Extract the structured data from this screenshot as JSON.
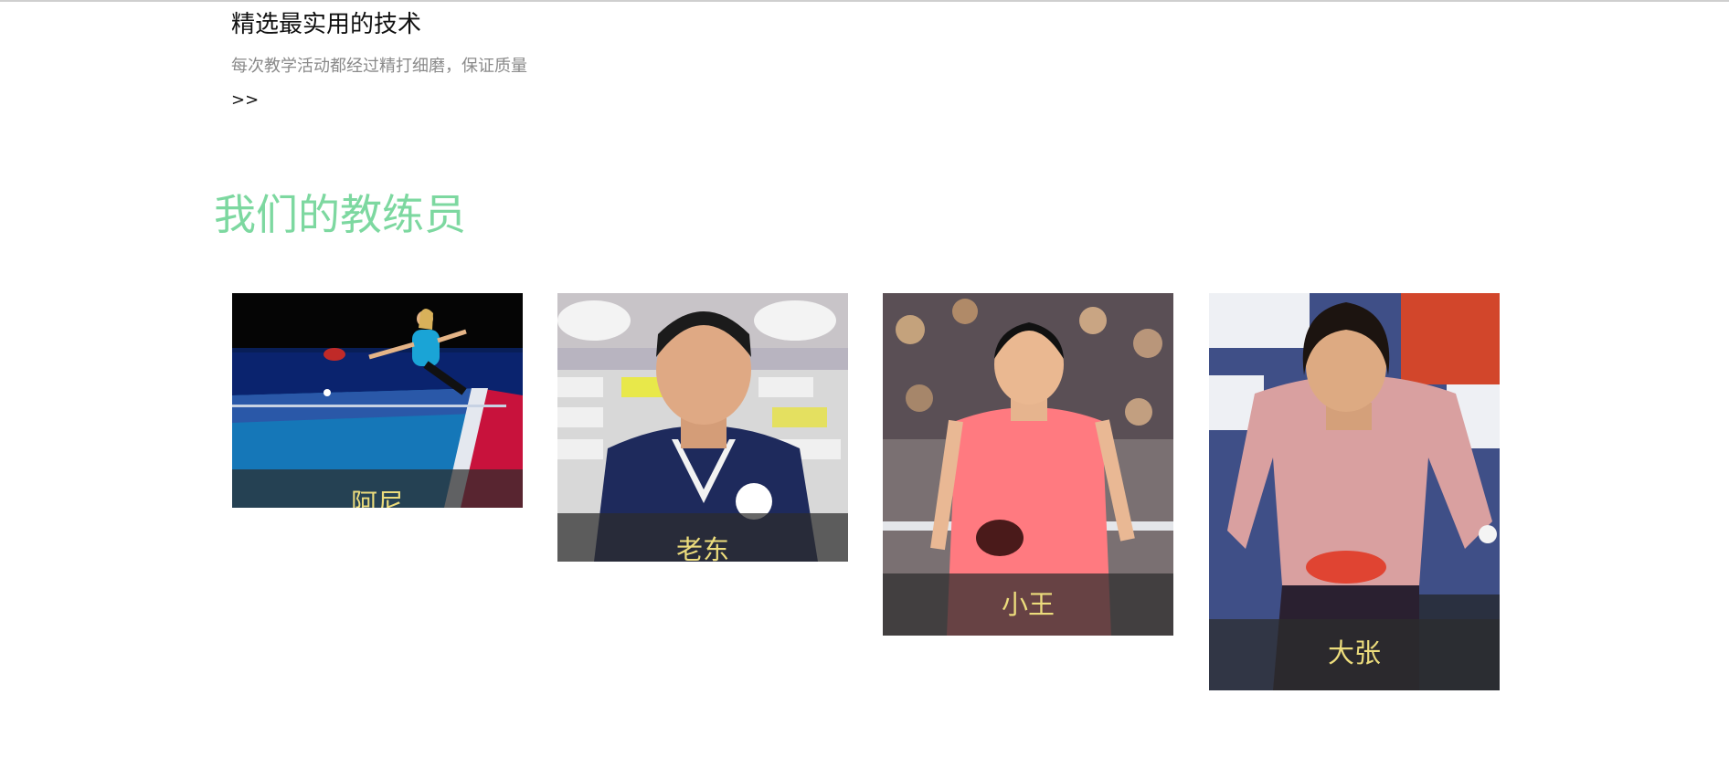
{
  "feature": {
    "title": "精选最实用的技术",
    "description": "每次教学活动都经过精打细磨，保证质量",
    "more_label": ">>"
  },
  "coaches_section": {
    "title": "我们的教练员",
    "coaches": [
      {
        "name": "阿尼",
        "photo": "female-table-tennis-player-at-blue-table"
      },
      {
        "name": "老东",
        "photo": "coach-portrait-navy-polo"
      },
      {
        "name": "小王",
        "photo": "player-pink-jersey-holding-paddle"
      },
      {
        "name": "大张",
        "photo": "player-pink-jersey-serving"
      }
    ]
  },
  "colors": {
    "section_title": "#7dd8a0",
    "caption_text": "#ecdc7c",
    "caption_bg": "#2d2d2d"
  }
}
